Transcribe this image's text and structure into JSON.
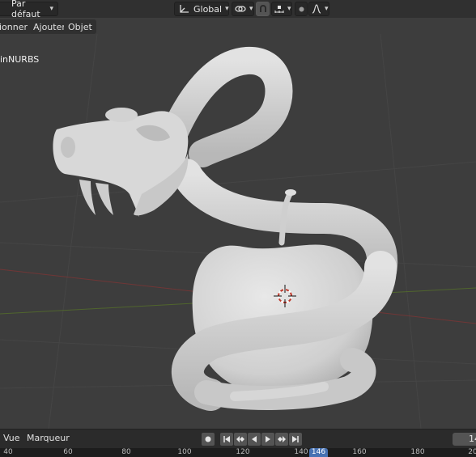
{
  "header": {
    "view_preset": "Par défaut",
    "transform_orientation": "Global",
    "icons": {
      "orientation": "transform-orientation-icon",
      "pivot": "link-pivot-icon",
      "snap": "snap-magnet-icon",
      "snap_target": "snap-increment-icon",
      "proportional": "proportional-edit-icon",
      "falloff": "falloff-curve-icon"
    }
  },
  "menubar": {
    "select_label": "ionner",
    "add_label": "Ajouter",
    "object_label": "Objet"
  },
  "viewport": {
    "object_name": "inNURBS",
    "colors": {
      "background": "#3d3d3d",
      "grid": "#454545",
      "x_axis": "#8b3a3a",
      "y_axis": "#5a7a2a",
      "model": "#d4d4d4"
    }
  },
  "timeline": {
    "view_label": "Vue",
    "marker_label": "Marqueur",
    "current_frame": "146",
    "frame_field_value": "14",
    "ticks": [
      "40",
      "60",
      "80",
      "100",
      "120",
      "140",
      "160",
      "180",
      "20"
    ]
  }
}
